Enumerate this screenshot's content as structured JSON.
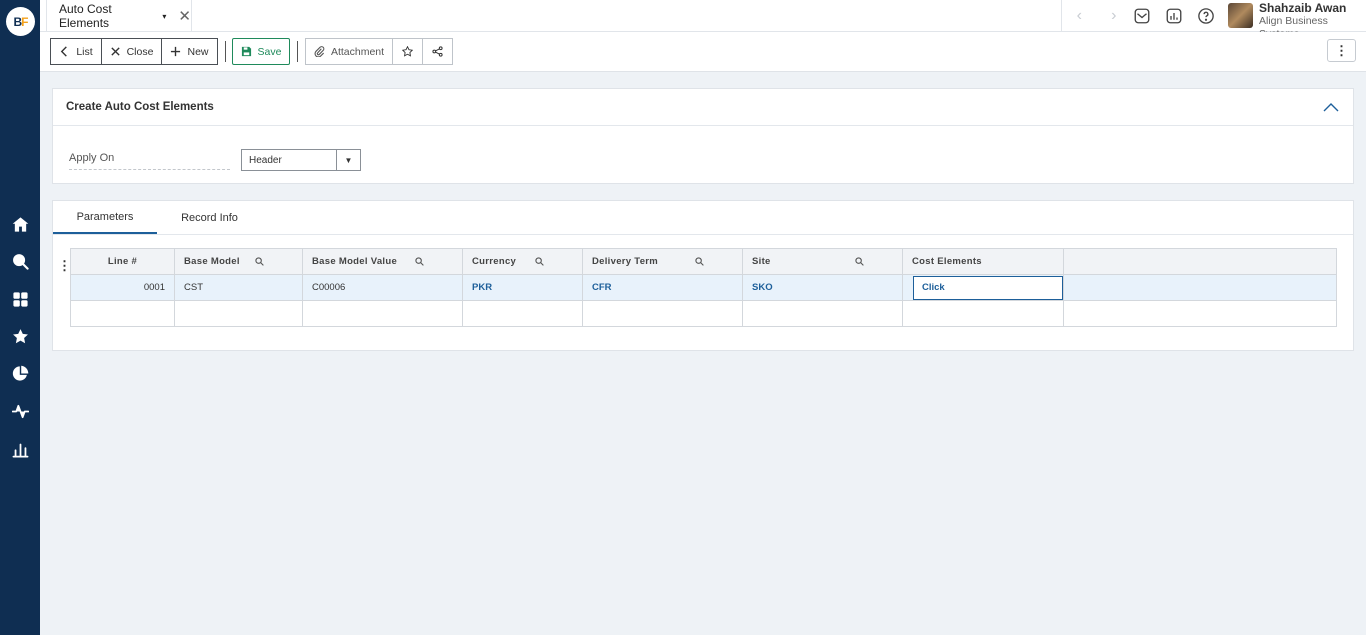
{
  "app": {
    "logo_text_b": "B",
    "logo_text_f": "F"
  },
  "rail": {
    "icons": [
      "home-icon",
      "search-icon",
      "apps-icon",
      "star-icon",
      "pie-chart-icon",
      "activity-icon",
      "bar-chart-icon"
    ]
  },
  "document_tab": {
    "title": "Auto Cost Elements",
    "caret": "▾",
    "close": "✕"
  },
  "nav": {
    "prev": "‹",
    "next": "›"
  },
  "user": {
    "name": "Shahzaib Awan",
    "company": "Align Business Systems"
  },
  "toolbar": {
    "list_label": "List",
    "close_label": "Close",
    "new_label": "New",
    "save_label": "Save",
    "attachment_label": "Attachment",
    "more_label": "⋮"
  },
  "form": {
    "title": "Create Auto Cost Elements",
    "apply_on": {
      "label": "Apply On",
      "value": "Header",
      "arrow": "▼"
    }
  },
  "tabs": [
    {
      "label": "Parameters",
      "active": true
    },
    {
      "label": "Record Info",
      "active": false
    }
  ],
  "grid": {
    "menu": "⋮",
    "columns": [
      "Line #",
      "Base Model",
      "Base Model Value",
      "Currency",
      "Delivery Term",
      "Site",
      "Cost Elements"
    ],
    "rows": [
      {
        "line": "0001",
        "base_model": "CST",
        "base_model_value": "C00006",
        "currency": "PKR",
        "delivery_term": "CFR",
        "site": "SKO",
        "cost_elements": "Click"
      }
    ]
  },
  "colors": {
    "rail": "#0f2e52",
    "accent": "#1d5f9a",
    "save": "#1f8a5b",
    "logo_f": "#f4a21c"
  }
}
